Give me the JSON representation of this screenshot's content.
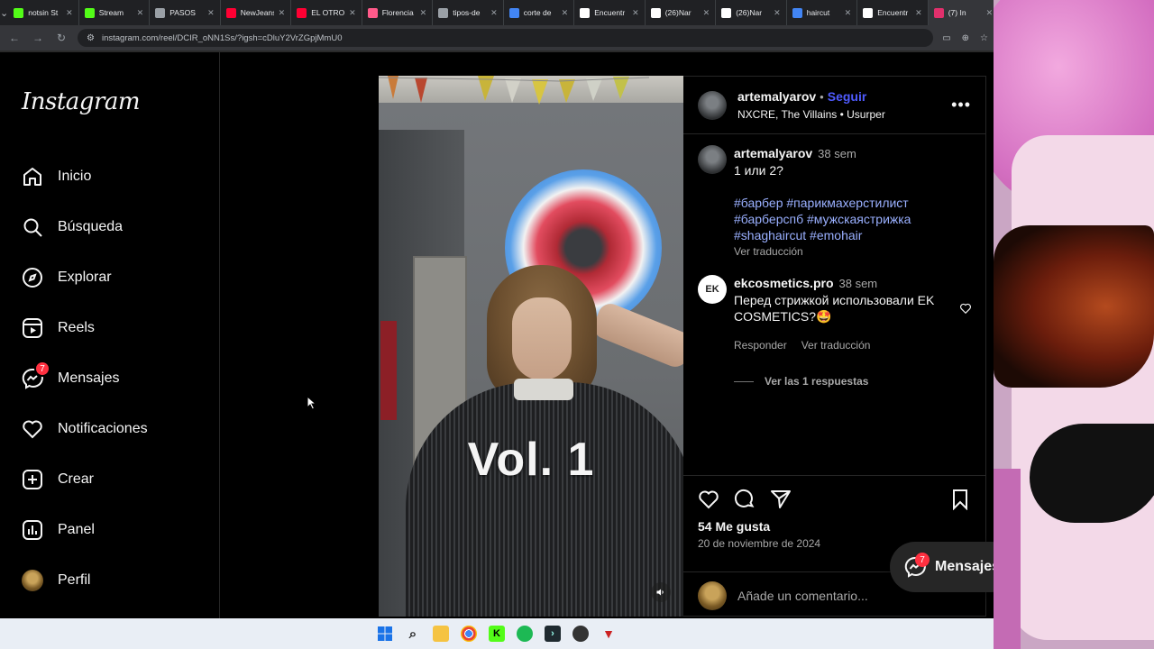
{
  "browser": {
    "tabs": [
      {
        "title": "notsin St",
        "icon": "kick-icon",
        "color": "#53fc18"
      },
      {
        "title": "Stream",
        "icon": "kick-icon",
        "color": "#53fc18"
      },
      {
        "title": "PASOS",
        "icon": "globe-icon",
        "color": "#9aa0a6"
      },
      {
        "title": "NewJeans",
        "icon": "youtube-icon",
        "color": "#ff0033"
      },
      {
        "title": "EL OTRO",
        "icon": "youtube-icon",
        "color": "#ff0033"
      },
      {
        "title": "Florencia",
        "icon": "app-icon",
        "color": "#ff5a8a"
      },
      {
        "title": "tipos-de",
        "icon": "globe-icon",
        "color": "#9aa0a6"
      },
      {
        "title": "corte de",
        "icon": "google-icon",
        "color": "#4285f4"
      },
      {
        "title": "Encuentr",
        "icon": "tiktok-icon",
        "color": "#ffffff"
      },
      {
        "title": "(26)Nar",
        "icon": "tiktok-icon",
        "color": "#ffffff"
      },
      {
        "title": "(26)Nar",
        "icon": "tiktok-icon",
        "color": "#ffffff"
      },
      {
        "title": "haircut",
        "icon": "google-icon",
        "color": "#4285f4"
      },
      {
        "title": "Encuentr",
        "icon": "tiktok-icon",
        "color": "#ffffff"
      },
      {
        "title": "(7) In",
        "icon": "instagram-icon",
        "color": "#e1306c",
        "active": true
      }
    ],
    "url": "instagram.com/reel/DCIR_oNN1Ss/?igsh=cDluY2VrZGpjMmU0"
  },
  "sidebar": {
    "logo": "Instagram",
    "items": [
      {
        "label": "Inicio",
        "icon": "home-icon"
      },
      {
        "label": "Búsqueda",
        "icon": "search-icon"
      },
      {
        "label": "Explorar",
        "icon": "compass-icon"
      },
      {
        "label": "Reels",
        "icon": "reels-icon"
      },
      {
        "label": "Mensajes",
        "icon": "messenger-icon",
        "badge": "7"
      },
      {
        "label": "Notificaciones",
        "icon": "heart-icon"
      },
      {
        "label": "Crear",
        "icon": "plus-square-icon"
      },
      {
        "label": "Panel",
        "icon": "chart-icon"
      },
      {
        "label": "Perfil",
        "icon": "profile-avatar"
      }
    ]
  },
  "reel": {
    "overlay_text": "Vol. 1"
  },
  "post": {
    "username": "artemalyarov",
    "follow_label": "Seguir",
    "audio": "NXCRE, The Villains • Usurper",
    "caption": {
      "username": "artemalyarov",
      "time": "38 sem",
      "text": "1 или 2?",
      "hashtags": [
        "#барбер #парикмахерстилист",
        "#барберспб #мужскаястрижка",
        "#shaghaircut #emohair"
      ],
      "translate": "Ver traducción"
    },
    "comment": {
      "avatar_text": "EK",
      "username": "ekcosmetics.pro",
      "time": "38 sem",
      "text": "Перед стрижкой использовали EK COSMETICS?🤩",
      "reply": "Responder",
      "translate": "Ver traducción",
      "replies": "Ver las 1 respuestas"
    },
    "likes": "54 Me gusta",
    "date": "20 de noviembre de 2024",
    "add_comment_placeholder": "Añade un comentario..."
  },
  "messages_pill": {
    "label": "Mensajes",
    "badge": "7"
  },
  "colors": {
    "follow_blue": "#4f5bff",
    "hashtag_blue": "#9ab0ff",
    "badge_red": "#ff3040",
    "background": "#000000"
  }
}
